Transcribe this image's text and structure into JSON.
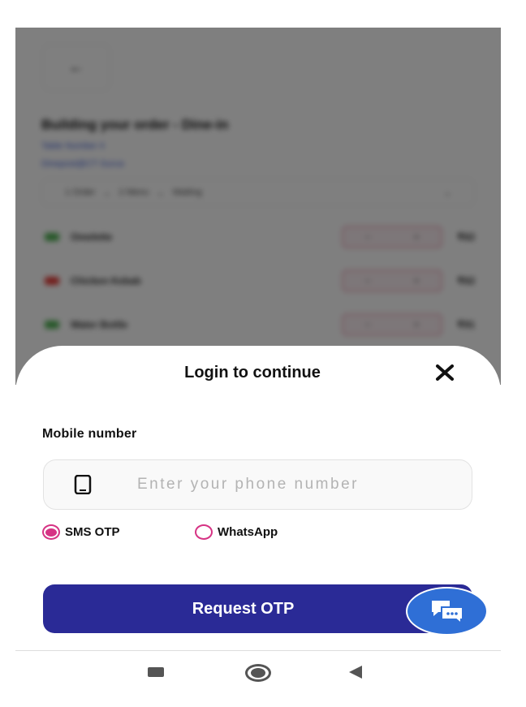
{
  "background_page": {
    "back_icon": "arrow-left-icon",
    "title": "Building your order - Dine-in",
    "subtitle_1": "Table Number 4",
    "subtitle_2": "Dinepost@CT Gurus",
    "filter_items": [
      "1 Order",
      "2 Menu",
      "Waiting"
    ],
    "items": [
      {
        "name": "Omelette",
        "veg": true,
        "price": "₹62"
      },
      {
        "name": "Chicken Kebab",
        "veg": false,
        "price": "₹62"
      },
      {
        "name": "Water Bottle",
        "veg": true,
        "price": "₹91"
      }
    ]
  },
  "login_sheet": {
    "title": "Login to continue",
    "close_icon": "close-icon",
    "mobile_label": "Mobile number",
    "phone_placeholder": "Enter your phone number",
    "phone_value": "",
    "otp_options": [
      {
        "label": "SMS OTP",
        "selected": true
      },
      {
        "label": "WhatsApp",
        "selected": false
      }
    ],
    "request_button": "Request OTP",
    "chat_icon": "chat-bubbles-icon"
  },
  "colors": {
    "primary_button": "#2a2a96",
    "radio_accent": "#d63384",
    "chat_fab": "#2f6fd6"
  }
}
